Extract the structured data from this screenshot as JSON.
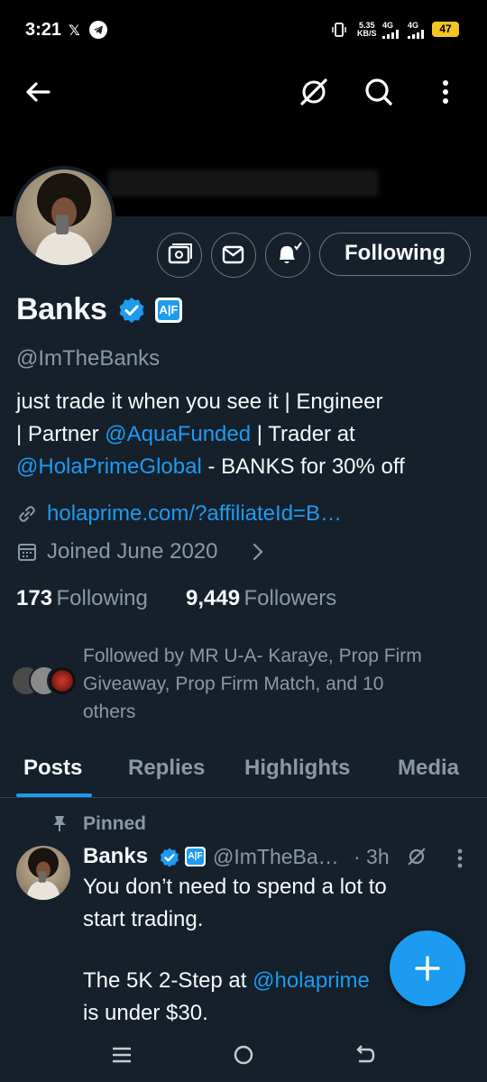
{
  "status_bar": {
    "time": "3:21",
    "x_glyph": "𝕏",
    "speed_value": "5.35",
    "speed_unit": "KB/S",
    "network_1": "4G",
    "network_2": "4G",
    "battery": "47"
  },
  "header": {
    "back_icon": "back-arrow-icon",
    "grok_icon": "grok-icon",
    "search_icon": "search-icon",
    "more_icon": "more-vertical-icon"
  },
  "profile": {
    "display_name": "Banks",
    "affiliate_badge": "A|F",
    "handle": "@ImTheBanks",
    "bio": {
      "line1": "just trade it when you see it | Engineer",
      "line2_pre": "| Partner ",
      "line2_link": "@AquaFunded",
      "line2_post": " | Trader at",
      "line3_link": "@HolaPrimeGlobal",
      "line3_post": " - BANKS for 30% off"
    },
    "website": "holaprime.com/?affiliateId=B…",
    "joined": "Joined June 2020",
    "following_count": "173",
    "following_label": "Following",
    "followers_count": "9,449",
    "followers_label": "Followers",
    "followed_by_line1": "Followed by MR U-A- Karaye, Prop Firm",
    "followed_by_line2": "Giveaway, Prop Firm Match, and 10",
    "followed_by_line3": "others"
  },
  "actions": {
    "following_button": "Following"
  },
  "tabs": [
    {
      "label": "Posts",
      "active": true
    },
    {
      "label": "Replies",
      "active": false
    },
    {
      "label": "Highlights",
      "active": false
    },
    {
      "label": "Media",
      "active": false
    }
  ],
  "pinned_post": {
    "pinned_label": "Pinned",
    "author_name": "Banks",
    "author_handle": "@ImTheBa…",
    "time": "· 3h",
    "line1": "You don’t need to spend a lot to",
    "line2": "start trading.",
    "line3_pre": "The 5K 2-Step at ",
    "line3_link": "@holaprime",
    "line4": "is under $30."
  },
  "colors": {
    "background": "#15202b",
    "accent": "#1d9bf0",
    "secondary_text": "#8b98a5",
    "battery": "#f2c522"
  }
}
